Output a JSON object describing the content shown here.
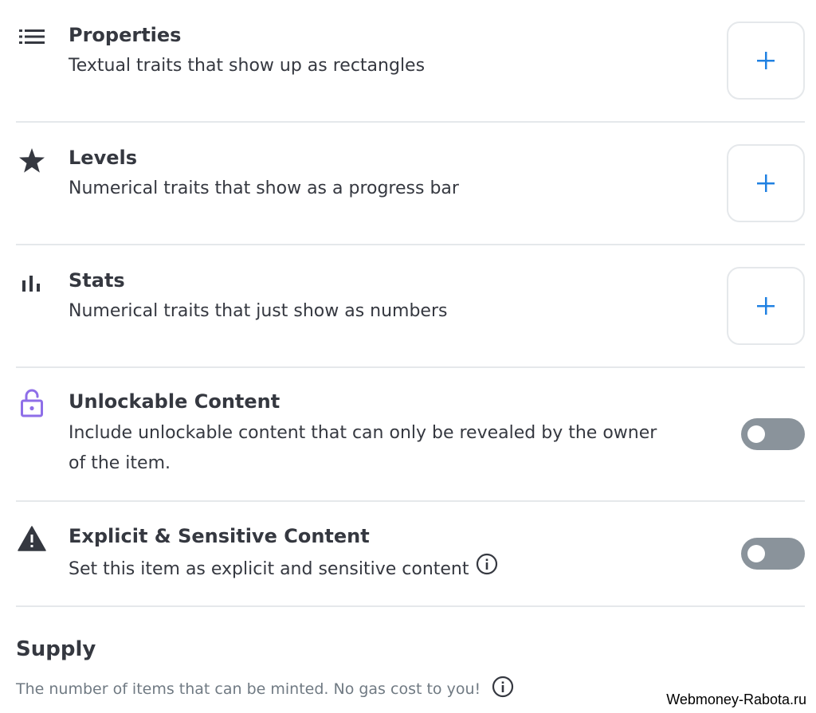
{
  "sections": {
    "properties": {
      "title": "Properties",
      "description": "Textual traits that show up as rectangles",
      "icon": "list-icon",
      "action": "+"
    },
    "levels": {
      "title": "Levels",
      "description": "Numerical traits that show as a progress bar",
      "icon": "star-icon",
      "action": "+"
    },
    "stats": {
      "title": "Stats",
      "description": "Numerical traits that just show as numbers",
      "icon": "bar-chart-icon",
      "action": "+"
    },
    "unlockable": {
      "title": "Unlockable Content",
      "description_line1": "Include unlockable content that can only be revealed by the owner",
      "description_line2": "of the item.",
      "icon": "lock-icon",
      "toggle_on": false
    },
    "explicit": {
      "title": "Explicit & Sensitive Content",
      "description": "Set this item as explicit and sensitive content",
      "icon": "warning-icon",
      "toggle_on": false
    }
  },
  "supply": {
    "title": "Supply",
    "description": "The number of items that can be minted. No gas cost to you!"
  },
  "watermark": "Webmoney-Rabota.ru",
  "colors": {
    "accent": "#2081e2",
    "lock_icon": "#8e6ee8",
    "toggle_off": "#8a939b",
    "divider": "#e5e8eb",
    "text": "#353840",
    "muted": "#707a83"
  }
}
